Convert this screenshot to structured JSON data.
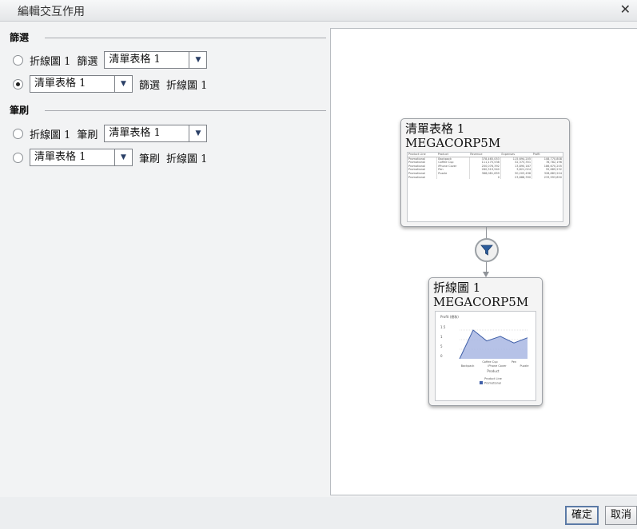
{
  "dialog": {
    "title": "編輯交互作用",
    "close_glyph": "✕"
  },
  "filter_section": {
    "heading": "篩選",
    "rows": [
      {
        "selected": false,
        "source_text": "折線圖 1",
        "action": "篩選",
        "target_select": "清單表格 1"
      },
      {
        "selected": true,
        "source_select": "清單表格 1",
        "action": "篩選",
        "target_text": "折線圖 1"
      }
    ]
  },
  "brush_section": {
    "heading": "筆刷",
    "rows": [
      {
        "selected": false,
        "source_text": "折線圖 1",
        "action": "筆刷",
        "target_select": "清單表格 1"
      },
      {
        "selected": false,
        "source_select": "清單表格 1",
        "action": "筆刷",
        "target_text": "折線圖 1"
      }
    ]
  },
  "diagram": {
    "source_card": {
      "title": "清單表格 1",
      "subtitle": "MEGACORP5M",
      "table": {
        "headers": [
          "Product Line",
          "Product",
          "Revenue",
          "Expenses",
          "Profit"
        ],
        "rows": [
          [
            "Promotional",
            "Backpack",
            "378,465,053",
            "115,694,205",
            "108,770,808"
          ],
          [
            "Promotional",
            "Coffee Cup",
            "111,175,538",
            "32,373,351",
            "78,782,196"
          ],
          [
            "Promotional",
            "iPhone Cover",
            "200,076,392",
            "13,890,187",
            "186,670,205"
          ],
          [
            "Promotional",
            "Pen",
            "260,319,940",
            "3,821,024",
            "55,689,232"
          ],
          [
            "Promotional",
            "Puzzle",
            "368,081,659",
            "30,203,496",
            "328,883,204"
          ],
          [
            "Promotional",
            "",
            "0",
            "23,688,390",
            "233,993,850"
          ]
        ]
      }
    },
    "connector_icon": "filter-funnel-icon",
    "target_card": {
      "title": "折線圖 1",
      "subtitle": "MEGACORP5M",
      "chart": {
        "ylabel": "Profit (總和)",
        "yticks": [
          "1.5",
          "1",
          "5",
          "0"
        ],
        "values": [
          0,
          100,
          62,
          78,
          55,
          73
        ],
        "xticks_top": [
          "Coffee Cup",
          "Pen"
        ],
        "xticks_bottom": [
          "Backpack",
          "iPhone Cover",
          "Puzzle"
        ],
        "xlabel": "Product",
        "legend_title": "Product Line",
        "legend_item": "Promotional",
        "series_color": "#3f5fa8",
        "fill_color": "#a9b7e3"
      }
    }
  },
  "footer": {
    "ok_label": "確定",
    "cancel_label": "取消"
  }
}
